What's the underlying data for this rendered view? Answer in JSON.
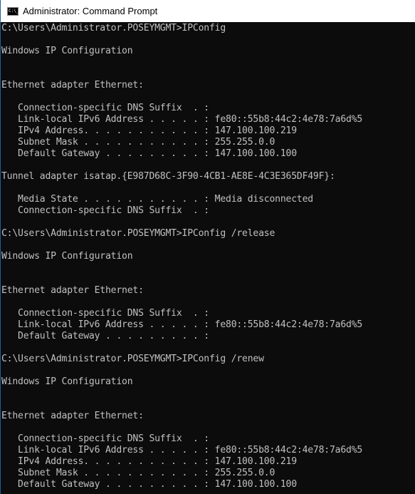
{
  "window": {
    "title": "Administrator: Command Prompt",
    "icon": "cmd-icon"
  },
  "console_lines": [
    "C:\\Users\\Administrator.POSEYMGMT>IPConfig",
    "",
    "Windows IP Configuration",
    "",
    "",
    "Ethernet adapter Ethernet:",
    "",
    "   Connection-specific DNS Suffix  . :",
    "   Link-local IPv6 Address . . . . . : fe80::55b8:44c2:4e78:7a6d%5",
    "   IPv4 Address. . . . . . . . . . . : 147.100.100.219",
    "   Subnet Mask . . . . . . . . . . . : 255.255.0.0",
    "   Default Gateway . . . . . . . . . : 147.100.100.100",
    "",
    "Tunnel adapter isatap.{E987D68C-3F90-4CB1-AE8E-4C3E365DF49F}:",
    "",
    "   Media State . . . . . . . . . . . : Media disconnected",
    "   Connection-specific DNS Suffix  . :",
    "",
    "C:\\Users\\Administrator.POSEYMGMT>IPConfig /release",
    "",
    "Windows IP Configuration",
    "",
    "",
    "Ethernet adapter Ethernet:",
    "",
    "   Connection-specific DNS Suffix  . :",
    "   Link-local IPv6 Address . . . . . : fe80::55b8:44c2:4e78:7a6d%5",
    "   Default Gateway . . . . . . . . . :",
    "",
    "C:\\Users\\Administrator.POSEYMGMT>IPConfig /renew",
    "",
    "Windows IP Configuration",
    "",
    "",
    "Ethernet adapter Ethernet:",
    "",
    "   Connection-specific DNS Suffix  . :",
    "   Link-local IPv6 Address . . . . . : fe80::55b8:44c2:4e78:7a6d%5",
    "   IPv4 Address. . . . . . . . . . . : 147.100.100.219",
    "   Subnet Mask . . . . . . . . . . . : 255.255.0.0",
    "   Default Gateway . . . . . . . . . : 147.100.100.100"
  ]
}
